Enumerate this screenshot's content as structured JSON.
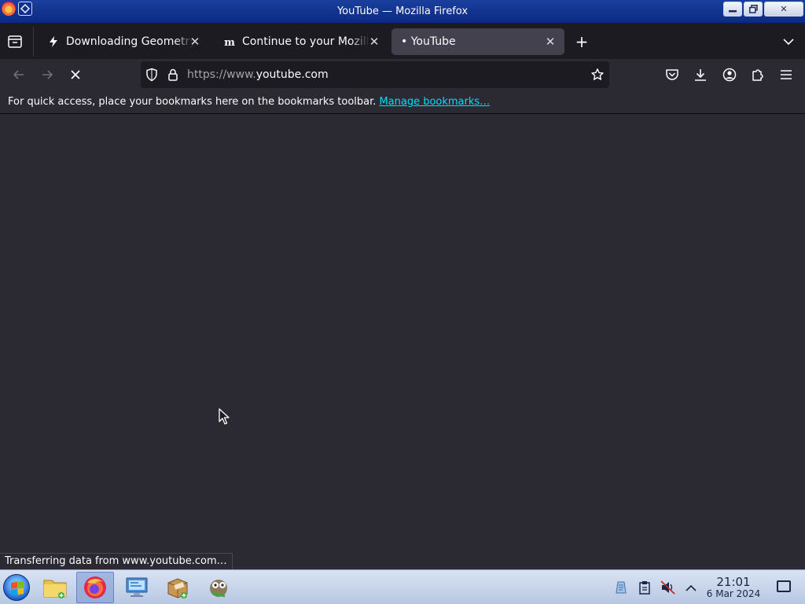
{
  "window": {
    "title": "YouTube — Mozilla Firefox",
    "close_glyph": "✕",
    "min_glyph": "▬",
    "max_glyph": "❐"
  },
  "tabs": [
    {
      "label": "Downloading Geometry Das",
      "icon": "bolt-icon",
      "active": false
    },
    {
      "label": "Continue to your Mozilla ac",
      "icon": "mozilla-m-icon",
      "active": false
    },
    {
      "label": "• YouTube",
      "icon": "",
      "active": true
    }
  ],
  "tab_close_glyph": "✕",
  "new_tab_glyph": "+",
  "navbar": {
    "url_scheme": "https://www.",
    "url_host": "youtube.com"
  },
  "bookmarks": {
    "message": "For quick access, place your bookmarks here on the bookmarks toolbar.",
    "link": "Manage bookmarks…"
  },
  "status": "Transferring data from www.youtube.com…",
  "taskbar": {
    "time": "21:01",
    "date": "6 Mar 2024"
  },
  "colors": {
    "accent": "#00ddff",
    "toolbar": "#2b2a33",
    "tabstrip": "#1c1b22",
    "active_tab": "#42414d",
    "titlebar": "#1a3f9c"
  }
}
